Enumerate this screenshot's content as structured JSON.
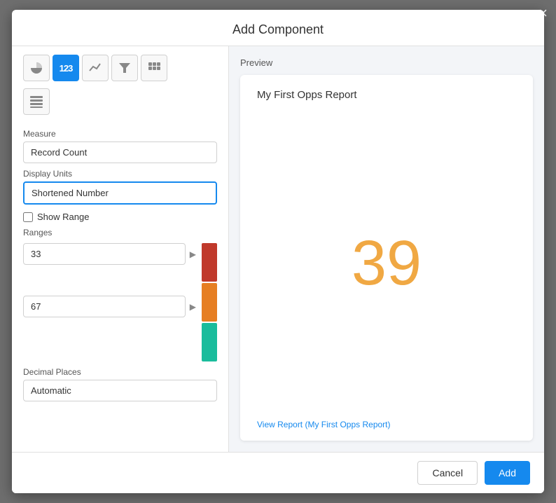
{
  "modal": {
    "title": "Add Component",
    "close_label": "×"
  },
  "icons": [
    {
      "name": "circle-icon",
      "label": "●",
      "active": false
    },
    {
      "name": "number-icon",
      "label": "123",
      "active": true
    },
    {
      "name": "mountain-icon",
      "label": "▲",
      "active": false
    },
    {
      "name": "funnel-icon",
      "label": "☰",
      "active": false
    },
    {
      "name": "grid-icon",
      "label": "⊞",
      "active": false
    },
    {
      "name": "table-icon",
      "label": "≡",
      "active": false
    }
  ],
  "form": {
    "measure_label": "Measure",
    "measure_value": "Record Count",
    "display_units_label": "Display Units",
    "display_units_value": "Shortened Number",
    "show_range_label": "Show Range",
    "show_range_checked": false,
    "ranges_label": "Ranges",
    "range1_value": "33",
    "range2_value": "67",
    "decimal_places_label": "Decimal Places",
    "decimal_places_value": "Automatic"
  },
  "colors": {
    "bar1": "#c0392b",
    "bar2": "#e67e22",
    "bar3": "#1abc9c"
  },
  "preview": {
    "label": "Preview",
    "report_title": "My First Opps Report",
    "number": "39",
    "link_text": "View Report (My First Opps Report)"
  },
  "footer": {
    "cancel_label": "Cancel",
    "add_label": "Add"
  }
}
